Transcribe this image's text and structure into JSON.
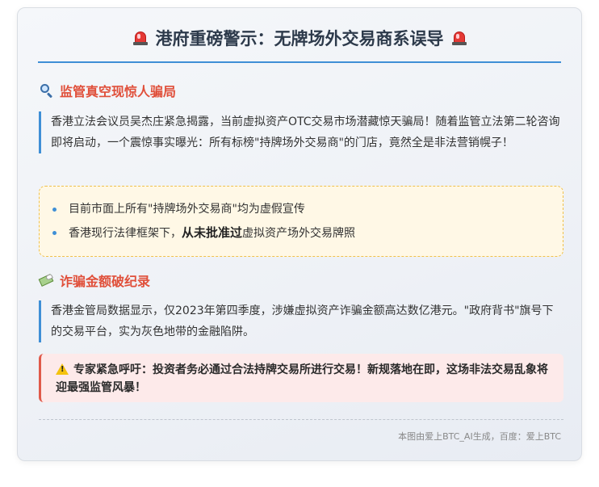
{
  "header": {
    "title": "港府重磅警示：无牌场外交易商系误导",
    "icons": [
      "siren-icon",
      "siren-icon"
    ]
  },
  "section1": {
    "icon": "magnifier-icon",
    "title": "监管真空现惊人骗局",
    "paragraph": "香港立法会议员吴杰庄紧急揭露，当前虚拟资产OTC交易市场潜藏惊天骗局！随着监管立法第二轮咨询即将启动，一个震惊事实曝光：所有标榜\"持牌场外交易商\"的门店，竟然全是非法营销幌子！"
  },
  "warnbox": {
    "item1": "目前市面上所有\"持牌场外交易商\"均为虚假宣传",
    "item2_prefix": "香港现行法律框架下，",
    "item2_strong": "从未批准过",
    "item2_suffix": "虚拟资产场外交易牌照"
  },
  "section2": {
    "icon": "money-with-wings-icon",
    "title": "诈骗金额破纪录",
    "paragraph": "香港金管局数据显示，仅2023年第四季度，涉嫌虚拟资产诈骗金额高达数亿港元。\"政府背书\"旗号下的交易平台，实为灰色地带的金融陷阱。"
  },
  "alert": {
    "icon": "warning-icon",
    "text": "专家紧急呼吁：投资者务必通过合法持牌交易所进行交易！新规落地在即，这场非法交易乱象将迎最强监管风暴！"
  },
  "footer": {
    "credit": "本图由爱上BTC_AI生成，百度：爱上BTC"
  },
  "colors": {
    "accent_blue": "#3f8fd6",
    "heading_red": "#e04f3a",
    "warn_bg": "#fff8e6",
    "alert_bg": "#fdeaea"
  }
}
